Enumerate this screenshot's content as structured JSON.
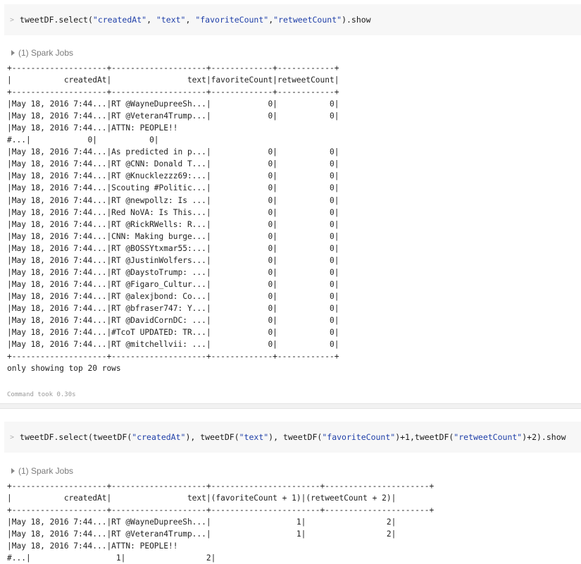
{
  "cell1": {
    "prompt": ">",
    "code": [
      {
        "t": "tweetDF.select(",
        "s": false
      },
      {
        "t": "\"createdAt\"",
        "s": true
      },
      {
        "t": ", ",
        "s": false
      },
      {
        "t": "\"text\"",
        "s": true
      },
      {
        "t": ", ",
        "s": false
      },
      {
        "t": "\"favoriteCount\"",
        "s": true
      },
      {
        "t": ",",
        "s": false
      },
      {
        "t": "\"retweetCount\"",
        "s": true
      },
      {
        "t": ").show",
        "s": false
      }
    ],
    "spark_jobs": "(1) Spark Jobs",
    "output_lines": [
      "+--------------------+--------------------+-------------+------------+",
      "|           createdAt|                text|favoriteCount|retweetCount|",
      "+--------------------+--------------------+-------------+------------+",
      "|May 18, 2016 7:44...|RT @WayneDupreeSh...|            0|           0|",
      "|May 18, 2016 7:44...|RT @Veteran4Trump...|            0|           0|",
      "|May 18, 2016 7:44...|ATTN: PEOPLE!!",
      "#...|            0|           0|",
      "|May 18, 2016 7:44...|As predicted in p...|            0|           0|",
      "|May 18, 2016 7:44...|RT @CNN: Donald T...|            0|           0|",
      "|May 18, 2016 7:44...|RT @Knucklezzz69:...|            0|           0|",
      "|May 18, 2016 7:44...|Scouting #Politic...|            0|           0|",
      "|May 18, 2016 7:44...|RT @newpollz: Is ...|            0|           0|",
      "|May 18, 2016 7:44...|Red NoVA: Is This...|            0|           0|",
      "|May 18, 2016 7:44...|RT @RickRWells: R...|            0|           0|",
      "|May 18, 2016 7:44...|CNN: Making burge...|            0|           0|",
      "|May 18, 2016 7:44...|RT @BOSSYtxmar55:...|            0|           0|",
      "|May 18, 2016 7:44...|RT @JustinWolfers...|            0|           0|",
      "|May 18, 2016 7:44...|RT @DaystoTrump: ...|            0|           0|",
      "|May 18, 2016 7:44...|RT @Figaro_Cultur...|            0|           0|",
      "|May 18, 2016 7:44...|RT @alexjbond: Co...|            0|           0|",
      "|May 18, 2016 7:44...|RT @bfraser747: Y...|            0|           0|",
      "|May 18, 2016 7:44...|RT @DavidCornDC: ...|            0|           0|",
      "|May 18, 2016 7:44...|#TcoT UPDATED: TR...|            0|           0|",
      "|May 18, 2016 7:44...|RT @mitchellvii: ...|            0|           0|",
      "+--------------------+--------------------+-------------+------------+",
      "only showing top 20 rows"
    ],
    "command_took": "Command took 0.30s"
  },
  "cell2": {
    "prompt": ">",
    "code": [
      {
        "t": "tweetDF.select(tweetDF(",
        "s": false
      },
      {
        "t": "\"createdAt\"",
        "s": true
      },
      {
        "t": "), tweetDF(",
        "s": false
      },
      {
        "t": "\"text\"",
        "s": true
      },
      {
        "t": "), tweetDF(",
        "s": false
      },
      {
        "t": "\"favoriteCount\"",
        "s": true
      },
      {
        "t": ")+1,tweetDF(",
        "s": false
      },
      {
        "t": "\"retweetCount\"",
        "s": true
      },
      {
        "t": ")+2).show",
        "s": false
      }
    ],
    "spark_jobs": "(1) Spark Jobs",
    "output_lines": [
      "+--------------------+--------------------+-----------------------+----------------------+",
      "|           createdAt|                text|(favoriteCount + 1)|(retweetCount + 2)|",
      "+--------------------+--------------------+-----------------------+----------------------+",
      "|May 18, 2016 7:44...|RT @WayneDupreeSh...|                  1|                 2|",
      "|May 18, 2016 7:44...|RT @Veteran4Trump...|                  1|                 2|",
      "|May 18, 2016 7:44...|ATTN: PEOPLE!!",
      "#...|                  1|                 2|"
    ]
  }
}
